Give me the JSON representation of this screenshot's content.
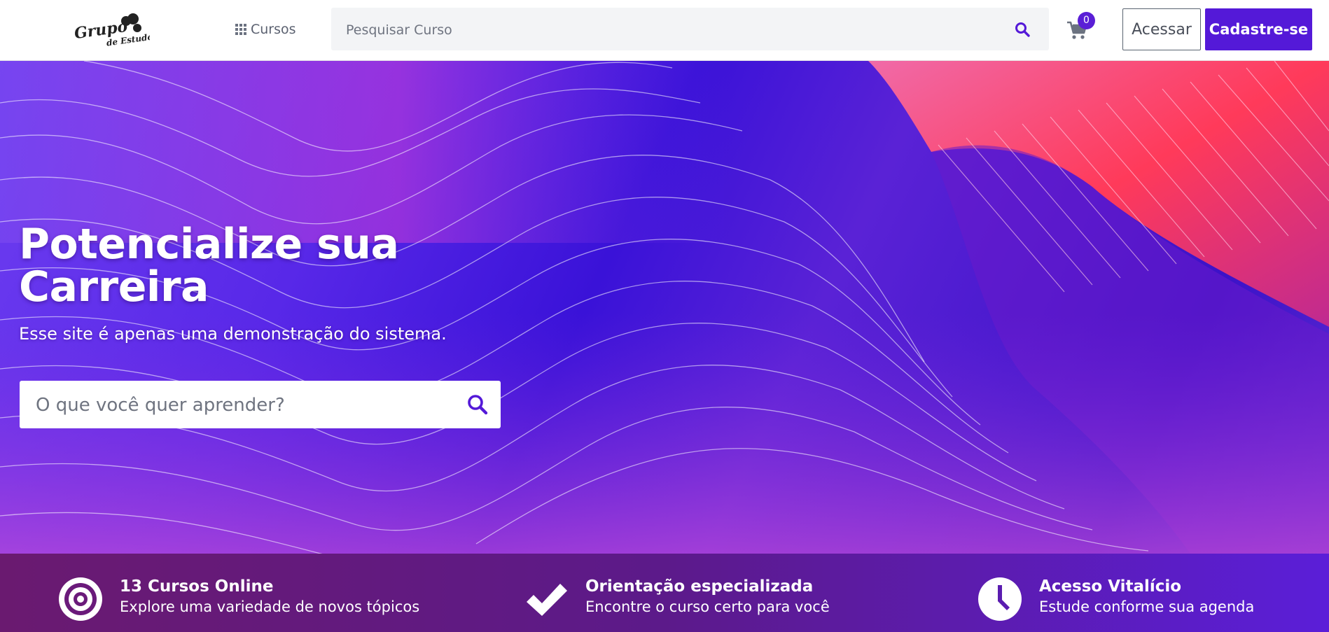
{
  "navbar": {
    "logo_text": "Grupo de Estudos",
    "cursos_label": "Cursos",
    "search_placeholder": "Pesquisar Curso",
    "cart_count": "0",
    "login_label": "Acessar",
    "signup_label": "Cadastre-se"
  },
  "hero": {
    "title": "Potencialize sua Carreira",
    "subtitle": "Esse site é apenas uma demonstração do sistema.",
    "search_placeholder": "O que você quer aprender?"
  },
  "features": [
    {
      "icon": "target-icon",
      "title": "13 Cursos Online",
      "text": "Explore uma variedade de novos tópicos"
    },
    {
      "icon": "check-icon",
      "title": "Orientação especializada",
      "text": "Encontre o curso certo para você"
    },
    {
      "icon": "clock-icon",
      "title": "Acesso Vitalício",
      "text": "Estude conforme sua agenda"
    }
  ],
  "colors": {
    "brand": "#5419d8",
    "hero_gradient_start": "#6d3df0",
    "hero_gradient_mid": "#3a12d8",
    "features_bg_start": "#6a1a70",
    "features_bg_end": "#5b1ed8"
  }
}
